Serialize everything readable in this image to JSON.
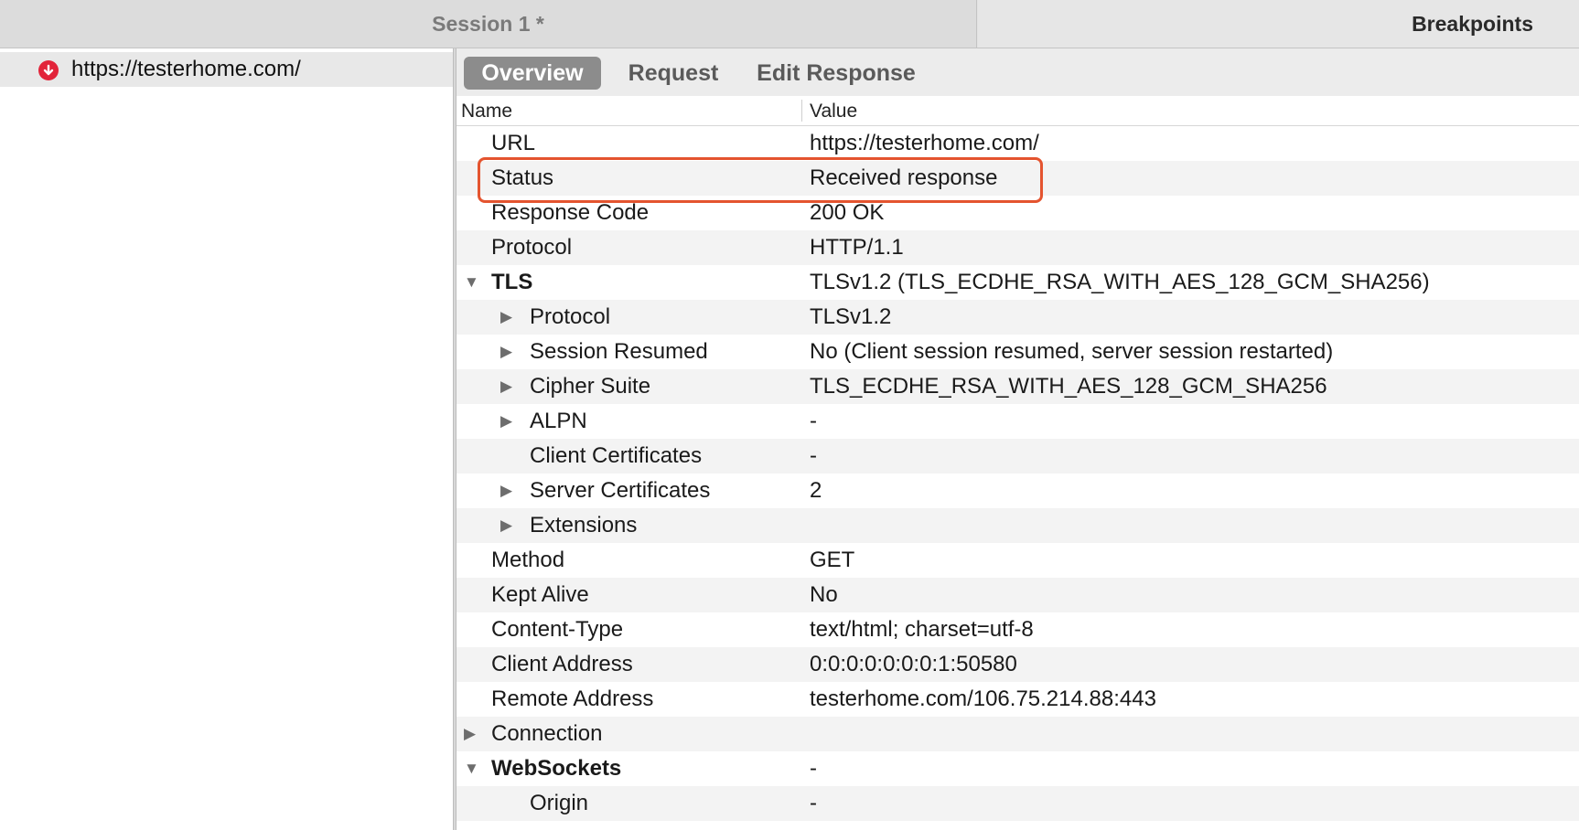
{
  "tabs": {
    "session": "Session 1 *",
    "breakpoints": "Breakpoints"
  },
  "session_list": {
    "items": [
      {
        "url": "https://testerhome.com/",
        "icon": "breakpoint-download-icon"
      }
    ]
  },
  "subtabs": [
    {
      "label": "Overview",
      "active": true
    },
    {
      "label": "Request",
      "active": false
    },
    {
      "label": "Edit Response",
      "active": false
    }
  ],
  "table": {
    "headers": {
      "name": "Name",
      "value": "Value"
    },
    "rows": [
      {
        "name": "URL",
        "value": "https://testerhome.com/"
      },
      {
        "name": "Status",
        "value": "Received response",
        "highlighted": true
      },
      {
        "name": "Response Code",
        "value": "200 OK"
      },
      {
        "name": "Protocol",
        "value": "HTTP/1.1"
      },
      {
        "name": "TLS",
        "value": "TLSv1.2 (TLS_ECDHE_RSA_WITH_AES_128_GCM_SHA256)",
        "expander": "expanded",
        "bold": true
      },
      {
        "name": "Protocol",
        "value": "TLSv1.2",
        "expander": "collapsed",
        "child": true
      },
      {
        "name": "Session Resumed",
        "value": "No (Client session resumed, server session restarted)",
        "expander": "collapsed",
        "child": true
      },
      {
        "name": "Cipher Suite",
        "value": "TLS_ECDHE_RSA_WITH_AES_128_GCM_SHA256",
        "expander": "collapsed",
        "child": true
      },
      {
        "name": "ALPN",
        "value": "-",
        "expander": "collapsed",
        "child": true
      },
      {
        "name": "Client Certificates",
        "value": "-",
        "child": true
      },
      {
        "name": "Server Certificates",
        "value": "2",
        "expander": "collapsed",
        "child": true
      },
      {
        "name": "Extensions",
        "value": "",
        "expander": "collapsed",
        "child": true
      },
      {
        "name": "Method",
        "value": "GET"
      },
      {
        "name": "Kept Alive",
        "value": "No"
      },
      {
        "name": "Content-Type",
        "value": "text/html; charset=utf-8"
      },
      {
        "name": "Client Address",
        "value": "0:0:0:0:0:0:0:1:50580"
      },
      {
        "name": "Remote Address",
        "value": "testerhome.com/106.75.214.88:443"
      },
      {
        "name": "Connection",
        "value": "",
        "expander": "collapsed"
      },
      {
        "name": "WebSockets",
        "value": "-",
        "expander": "expanded",
        "bold": true
      },
      {
        "name": "Origin",
        "value": "-",
        "child": true
      }
    ]
  },
  "colors": {
    "highlight_border": "#e4542f",
    "breakpoint_icon": "#e2243a",
    "active_subtab": "#8c8c8c"
  }
}
